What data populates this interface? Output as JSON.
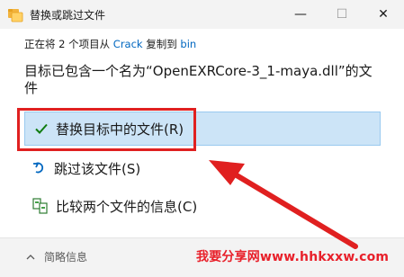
{
  "window": {
    "title": "替换或跳过文件"
  },
  "info": {
    "prefix": "正在将 2 个项目从 ",
    "source": "Crack",
    "middle": " 复制到 ",
    "destination": "bin"
  },
  "headline": "目标已包含一个名为“OpenEXRCore-3_1-maya.dll”的文件",
  "options": {
    "replace": "替换目标中的文件(R)",
    "skip": "跳过该文件(S)",
    "compare": "比较两个文件的信息(C)"
  },
  "footer": {
    "details_label": "简略信息"
  },
  "watermark": "我要分享网www.hhkxxw.com",
  "colors": {
    "accent": "#0067c0",
    "selected_bg": "#cce4f7",
    "annotation": "#e02020"
  }
}
